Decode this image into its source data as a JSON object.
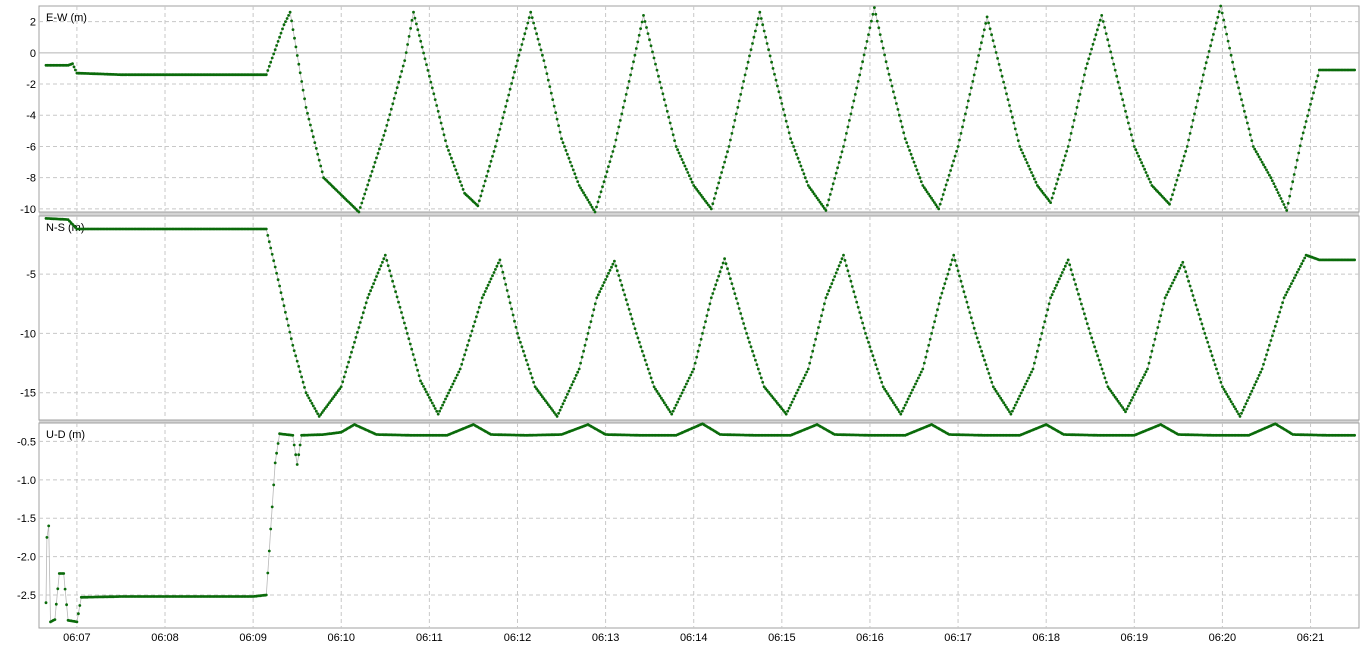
{
  "chart_data": [
    {
      "type": "scatter",
      "title": "E-W (m)",
      "ylim": [
        -10.2,
        3.0
      ],
      "yticks": [
        2,
        0,
        -2,
        -4,
        -6,
        -8,
        -10
      ],
      "grid": true,
      "baseline": 0,
      "series": [
        {
          "color": "#0b6b0b",
          "points": [
            [
              6.65,
              -0.8
            ],
            [
              6.9,
              -0.8
            ],
            [
              6.95,
              -0.7
            ],
            [
              7.0,
              -1.3
            ],
            [
              7.5,
              -1.4
            ],
            [
              8.0,
              -1.4
            ],
            [
              8.5,
              -1.4
            ],
            [
              9.0,
              -1.4
            ],
            [
              9.15,
              -1.4
            ],
            [
              9.25,
              0.2
            ],
            [
              9.35,
              1.8
            ],
            [
              9.42,
              2.6
            ],
            [
              9.6,
              -3.5
            ],
            [
              9.8,
              -8.0
            ],
            [
              10.2,
              -10.2
            ],
            [
              10.5,
              -5.0
            ],
            [
              10.72,
              -0.5
            ],
            [
              10.82,
              2.6
            ],
            [
              11.0,
              -1.5
            ],
            [
              11.2,
              -6.0
            ],
            [
              11.4,
              -9.0
            ],
            [
              11.55,
              -9.8
            ],
            [
              11.75,
              -6.0
            ],
            [
              12.0,
              -0.5
            ],
            [
              12.15,
              2.6
            ],
            [
              12.3,
              -0.5
            ],
            [
              12.5,
              -5.5
            ],
            [
              12.7,
              -8.5
            ],
            [
              12.88,
              -10.2
            ],
            [
              13.1,
              -6.0
            ],
            [
              13.3,
              -1.0
            ],
            [
              13.43,
              2.4
            ],
            [
              13.6,
              -1.5
            ],
            [
              13.8,
              -6.0
            ],
            [
              14.0,
              -8.5
            ],
            [
              14.2,
              -10.0
            ],
            [
              14.4,
              -6.0
            ],
            [
              14.6,
              -1.0
            ],
            [
              14.75,
              2.6
            ],
            [
              14.9,
              -1.0
            ],
            [
              15.1,
              -5.5
            ],
            [
              15.3,
              -8.5
            ],
            [
              15.5,
              -10.1
            ],
            [
              15.7,
              -6.0
            ],
            [
              15.9,
              -1.0
            ],
            [
              16.05,
              2.9
            ],
            [
              16.2,
              -1.0
            ],
            [
              16.4,
              -5.5
            ],
            [
              16.6,
              -8.5
            ],
            [
              16.78,
              -10.0
            ],
            [
              17.0,
              -6.0
            ],
            [
              17.2,
              -1.0
            ],
            [
              17.33,
              2.3
            ],
            [
              17.5,
              -1.5
            ],
            [
              17.7,
              -6.0
            ],
            [
              17.9,
              -8.5
            ],
            [
              18.05,
              -9.6
            ],
            [
              18.25,
              -6.0
            ],
            [
              18.45,
              -1.0
            ],
            [
              18.63,
              2.4
            ],
            [
              18.8,
              -1.5
            ],
            [
              19.0,
              -6.0
            ],
            [
              19.2,
              -8.5
            ],
            [
              19.4,
              -9.7
            ],
            [
              19.6,
              -6.0
            ],
            [
              19.8,
              -1.0
            ],
            [
              19.98,
              3.0
            ],
            [
              20.15,
              -1.5
            ],
            [
              20.35,
              -6.0
            ],
            [
              20.55,
              -8.0
            ],
            [
              20.73,
              -10.1
            ],
            [
              20.9,
              -5.5
            ],
            [
              21.1,
              -1.1
            ],
            [
              21.5,
              -1.1
            ]
          ]
        }
      ]
    },
    {
      "type": "scatter",
      "title": "N-S (m)",
      "ylim": [
        -17.3,
        -0.1
      ],
      "yticks": [
        -5,
        -10,
        -15
      ],
      "grid": true,
      "series": [
        {
          "color": "#0b6b0b",
          "points": [
            [
              6.65,
              -0.3
            ],
            [
              6.9,
              -0.4
            ],
            [
              7.0,
              -1.2
            ],
            [
              7.5,
              -1.2
            ],
            [
              8.0,
              -1.2
            ],
            [
              8.5,
              -1.2
            ],
            [
              9.0,
              -1.2
            ],
            [
              9.15,
              -1.2
            ],
            [
              9.3,
              -6.0
            ],
            [
              9.45,
              -11.0
            ],
            [
              9.6,
              -15.0
            ],
            [
              9.75,
              -17.0
            ],
            [
              10.0,
              -14.5
            ],
            [
              10.3,
              -7.0
            ],
            [
              10.5,
              -3.4
            ],
            [
              10.75,
              -10.0
            ],
            [
              10.9,
              -14.0
            ],
            [
              11.1,
              -16.8
            ],
            [
              11.35,
              -13.0
            ],
            [
              11.6,
              -7.0
            ],
            [
              11.8,
              -3.8
            ],
            [
              12.0,
              -10.0
            ],
            [
              12.2,
              -14.5
            ],
            [
              12.45,
              -17.0
            ],
            [
              12.7,
              -13.0
            ],
            [
              12.9,
              -7.0
            ],
            [
              13.1,
              -3.9
            ],
            [
              13.35,
              -10.0
            ],
            [
              13.55,
              -14.5
            ],
            [
              13.75,
              -16.8
            ],
            [
              14.0,
              -13.0
            ],
            [
              14.2,
              -7.0
            ],
            [
              14.35,
              -3.7
            ],
            [
              14.6,
              -10.0
            ],
            [
              14.8,
              -14.5
            ],
            [
              15.05,
              -16.8
            ],
            [
              15.3,
              -13.0
            ],
            [
              15.5,
              -7.0
            ],
            [
              15.7,
              -3.4
            ],
            [
              15.95,
              -10.0
            ],
            [
              16.15,
              -14.5
            ],
            [
              16.35,
              -16.8
            ],
            [
              16.6,
              -13.0
            ],
            [
              16.8,
              -7.0
            ],
            [
              16.95,
              -3.4
            ],
            [
              17.2,
              -10.0
            ],
            [
              17.4,
              -14.5
            ],
            [
              17.6,
              -16.8
            ],
            [
              17.85,
              -13.0
            ],
            [
              18.05,
              -7.0
            ],
            [
              18.25,
              -3.8
            ],
            [
              18.5,
              -10.0
            ],
            [
              18.7,
              -14.5
            ],
            [
              18.9,
              -16.6
            ],
            [
              19.15,
              -13.0
            ],
            [
              19.35,
              -7.0
            ],
            [
              19.55,
              -4.0
            ],
            [
              19.8,
              -10.0
            ],
            [
              20.0,
              -14.5
            ],
            [
              20.2,
              -17.0
            ],
            [
              20.45,
              -13.0
            ],
            [
              20.7,
              -7.0
            ],
            [
              20.95,
              -3.4
            ],
            [
              21.1,
              -3.8
            ],
            [
              21.5,
              -3.8
            ]
          ]
        }
      ]
    },
    {
      "type": "scatter",
      "title": "U-D (m)",
      "ylim": [
        -2.93,
        -0.26
      ],
      "yticks": [
        -0.5,
        -1.0,
        -1.5,
        -2.0,
        -2.5
      ],
      "grid": true,
      "xticks": [
        "06:07",
        "06:08",
        "06:09",
        "06:10",
        "06:11",
        "06:12",
        "06:13",
        "06:14",
        "06:15",
        "06:16",
        "06:17",
        "06:18",
        "06:19",
        "06:20",
        "06:21"
      ],
      "series": [
        {
          "color": "#0b6b0b",
          "points": [
            [
              6.65,
              -2.6
            ],
            [
              6.66,
              -1.75
            ],
            [
              6.68,
              -1.6
            ],
            [
              6.7,
              -2.85
            ],
            [
              6.75,
              -2.82
            ],
            [
              6.8,
              -2.22
            ],
            [
              6.85,
              -2.22
            ],
            [
              6.9,
              -2.83
            ],
            [
              7.0,
              -2.85
            ],
            [
              7.05,
              -2.53
            ],
            [
              7.5,
              -2.52
            ],
            [
              8.0,
              -2.52
            ],
            [
              8.5,
              -2.52
            ],
            [
              9.0,
              -2.52
            ],
            [
              9.15,
              -2.5
            ],
            [
              9.25,
              -0.78
            ],
            [
              9.3,
              -0.4
            ],
            [
              9.45,
              -0.42
            ],
            [
              9.5,
              -0.8
            ],
            [
              9.55,
              -0.42
            ],
            [
              9.8,
              -0.41
            ],
            [
              10.0,
              -0.38
            ],
            [
              10.15,
              -0.28
            ],
            [
              10.4,
              -0.41
            ],
            [
              10.8,
              -0.42
            ],
            [
              11.2,
              -0.42
            ],
            [
              11.5,
              -0.28
            ],
            [
              11.7,
              -0.41
            ],
            [
              12.1,
              -0.42
            ],
            [
              12.5,
              -0.41
            ],
            [
              12.8,
              -0.28
            ],
            [
              13.0,
              -0.41
            ],
            [
              13.4,
              -0.42
            ],
            [
              13.8,
              -0.42
            ],
            [
              14.1,
              -0.27
            ],
            [
              14.3,
              -0.41
            ],
            [
              14.7,
              -0.42
            ],
            [
              15.1,
              -0.42
            ],
            [
              15.4,
              -0.28
            ],
            [
              15.6,
              -0.41
            ],
            [
              16.0,
              -0.42
            ],
            [
              16.4,
              -0.42
            ],
            [
              16.7,
              -0.28
            ],
            [
              16.9,
              -0.41
            ],
            [
              17.3,
              -0.42
            ],
            [
              17.7,
              -0.42
            ],
            [
              18.0,
              -0.28
            ],
            [
              18.2,
              -0.41
            ],
            [
              18.6,
              -0.42
            ],
            [
              19.0,
              -0.42
            ],
            [
              19.3,
              -0.28
            ],
            [
              19.5,
              -0.41
            ],
            [
              19.9,
              -0.42
            ],
            [
              20.3,
              -0.42
            ],
            [
              20.6,
              -0.27
            ],
            [
              20.8,
              -0.41
            ],
            [
              21.2,
              -0.42
            ],
            [
              21.5,
              -0.42
            ]
          ]
        }
      ]
    }
  ]
}
